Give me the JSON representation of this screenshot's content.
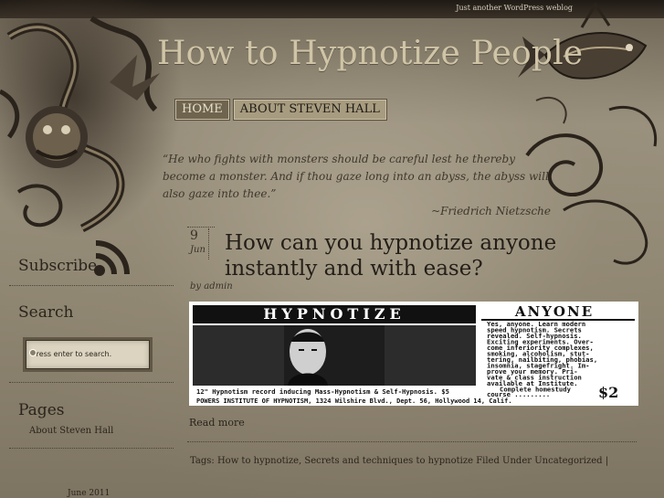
{
  "header": {
    "tagline": "Just another WordPress weblog",
    "site_title": "How to Hypnotize People"
  },
  "nav": {
    "items": [
      {
        "label": "Home",
        "active": true
      },
      {
        "label": "About Steven Hall",
        "active": false
      }
    ]
  },
  "quote": {
    "text": "“He who fights with monsters should be careful lest he thereby become a monster. And if thou gaze long into an abyss, the abyss will also gaze into thee.”",
    "author": "~Friedrich Nietzsche"
  },
  "sidebar": {
    "subscribe_heading": "Subscribe",
    "rss_icon": "rss-feed-icon",
    "search_heading": "Search",
    "search_placeholder": "Press enter to search.",
    "pages_heading": "Pages",
    "pages_items": [
      "About Steven Hall"
    ],
    "archive_items": [
      "June 2011"
    ]
  },
  "post": {
    "date_day": "9",
    "date_month": "Jun",
    "title": "How can you hypnotize anyone instantly and with ease?",
    "byline": "by admin",
    "ad": {
      "heading_left": "HYPNOTIZE",
      "heading_right": "ANYONE",
      "body": [
        "Yes, anyone. Learn modern",
        "speed hypnotism. Secrets",
        "revealed. Self-hypnosis.",
        "Exciting experiments. Over-",
        "come inferiority complexes,",
        "smoking, alcoholism, stut-",
        "tering, nailbiting, phobias,",
        "insomnia, stagefright. Im-",
        "prove your memory. Pri-",
        "vate & class instruction",
        "available at Institute.",
        "Complete homestudy",
        "course ........."
      ],
      "price": "$2",
      "record_line": "12\" Hypnotism record inducing Mass-Hypnotism & Self-Hypnosis.  $5",
      "address_line": "POWERS INSTITUTE OF HYPNOTISM, 1324 Wilshire Blvd., Dept. 56, Hollywood 14, Calif."
    },
    "read_more": "Read more",
    "tags_label": "Tags:",
    "tags": [
      "How to hypnotize",
      "Secrets and techniques to hypnotize"
    ],
    "filed_under_label": "Filed Under",
    "category": "Uncategorized",
    "trailing": "|"
  },
  "colors": {
    "background": "#8e8470",
    "topbar": "#2a241c",
    "title": "#cfc4a6",
    "nav_active": "#6f654f",
    "nav": "#a89c80"
  }
}
